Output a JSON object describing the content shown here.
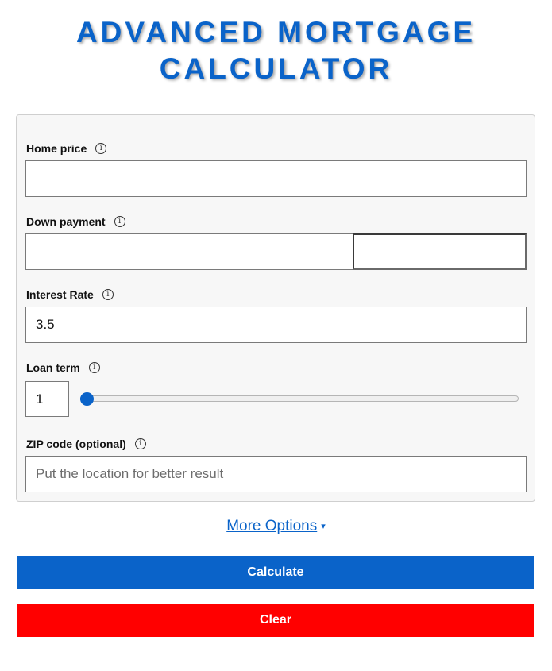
{
  "title": {
    "line1": "ADVANCED MORTGAGE",
    "line2": "CALCULATOR"
  },
  "form": {
    "home_price": {
      "label": "Home price",
      "value": "",
      "info_icon": "info-icon"
    },
    "down_payment": {
      "label": "Down payment",
      "value": "",
      "percent_value": "",
      "info_icon": "info-icon"
    },
    "interest_rate": {
      "label": "Interest Rate",
      "value": "3.5",
      "info_icon": "info-icon"
    },
    "loan_term": {
      "label": "Loan term",
      "value": "1",
      "slider_level": 0.0,
      "info_icon": "info-icon"
    },
    "zip_code": {
      "label": "ZIP code (optional)",
      "value": "",
      "placeholder": "Put the location for better result",
      "info_icon": "info-icon"
    }
  },
  "more_options": {
    "label": "More Options",
    "caret": "▾"
  },
  "buttons": {
    "calculate": "Calculate",
    "clear": "Clear"
  },
  "colors": {
    "accent": "#0a63c9",
    "clear": "#ff0000",
    "card_bg": "#f7f7f7"
  }
}
